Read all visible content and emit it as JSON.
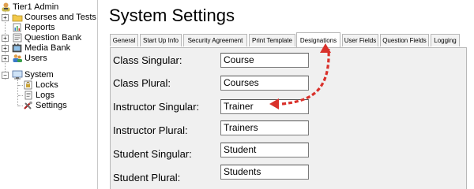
{
  "tree": {
    "root": "Tier1 Admin",
    "items": [
      {
        "label": "Courses and Tests",
        "expander": "+"
      },
      {
        "label": "Reports",
        "expander": ""
      },
      {
        "label": "Question Bank",
        "expander": "+"
      },
      {
        "label": "Media Bank",
        "expander": "+"
      },
      {
        "label": "Users",
        "expander": "+"
      },
      {
        "label": "System",
        "expander": "−"
      }
    ],
    "system_children": [
      "Locks",
      "Logs",
      "Settings"
    ]
  },
  "page": {
    "title": "System Settings"
  },
  "tabs": [
    {
      "label": "General"
    },
    {
      "label": "Start Up Info"
    },
    {
      "label": "Security Agreement"
    },
    {
      "label": "Print Template"
    },
    {
      "label": "Designations",
      "active": true
    },
    {
      "label": "User Fields"
    },
    {
      "label": "Question Fields"
    },
    {
      "label": "Logging"
    }
  ],
  "designations": [
    {
      "label": "Class Singular:",
      "value": "Course"
    },
    {
      "label": "Class Plural:",
      "value": "Courses"
    },
    {
      "label": "Instructor Singular:",
      "value": "Trainer"
    },
    {
      "label": "Instructor Plural:",
      "value": "Trainers"
    },
    {
      "label": "Student Singular:",
      "value": "Student"
    },
    {
      "label": "Student Plural:",
      "value": "Students"
    }
  ],
  "annotation": {
    "arrow_color": "#d9312b"
  }
}
